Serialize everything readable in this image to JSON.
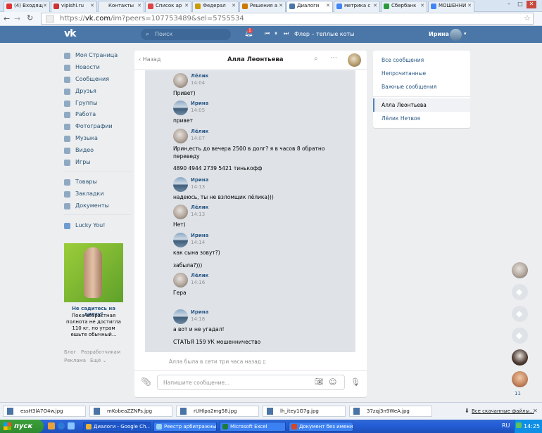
{
  "browser": {
    "tabs": [
      {
        "label": "(4) Входящ",
        "active": false
      },
      {
        "label": "vipishi.ru",
        "active": false
      },
      {
        "label": "Контакты",
        "active": false
      },
      {
        "label": "Список ар",
        "active": false
      },
      {
        "label": "Федерал",
        "active": false
      },
      {
        "label": "Решения а",
        "active": false
      },
      {
        "label": "Диалоги",
        "active": true
      },
      {
        "label": "метрика с",
        "active": false
      },
      {
        "label": "Сбербанк",
        "active": false
      },
      {
        "label": "МОШЕННИ",
        "active": false
      }
    ],
    "url_prefix": "https://",
    "url_host": "vk.com",
    "url_path": "/im?peers=107753489&sel=5755534"
  },
  "header": {
    "search_placeholder": "Поиск",
    "notification_count": "1",
    "now_playing": "Флер – теплые коты",
    "user_name": "Ирина"
  },
  "left_nav": {
    "items": [
      {
        "label": "Моя Страница",
        "icon": "home-icon"
      },
      {
        "label": "Новости",
        "icon": "news-icon"
      },
      {
        "label": "Сообщения",
        "icon": "messages-icon"
      },
      {
        "label": "Друзья",
        "icon": "friends-icon"
      },
      {
        "label": "Группы",
        "icon": "groups-icon"
      },
      {
        "label": "Работа",
        "icon": "work-icon"
      },
      {
        "label": "Фотографии",
        "icon": "photo-icon"
      },
      {
        "label": "Музыка",
        "icon": "music-icon"
      },
      {
        "label": "Видео",
        "icon": "video-icon"
      },
      {
        "label": "Игры",
        "icon": "games-icon"
      }
    ],
    "items2": [
      {
        "label": "Товары",
        "icon": "goods-icon"
      },
      {
        "label": "Закладки",
        "icon": "bookmarks-icon"
      },
      {
        "label": "Документы",
        "icon": "documents-icon"
      }
    ],
    "app": "Lucky You!",
    "ad_title": "Не садитесь на диету!",
    "ad_text": "Пока возрастная полнота не достигла 110 кг, по утрам ешьте обычный...",
    "footer": [
      "Блог",
      "Разработчикам",
      "Реклама",
      "Ещё"
    ]
  },
  "chat": {
    "back_label": "Назад",
    "title": "Алла Леонтьева",
    "messages": [
      {
        "author": "Лёлик",
        "time": "14:04",
        "lines": [
          "Привет)"
        ],
        "avatar": "lelik"
      },
      {
        "author": "Ирина",
        "time": "14:05",
        "lines": [
          "привет"
        ],
        "avatar": "irina"
      },
      {
        "author": "Лёлик",
        "time": "14:07",
        "lines": [
          "Ирин,есть до вечера 2500 в долг? я в часов 8 обратно",
          "переведу",
          "4890 4944 2739 5421 тинькофф"
        ],
        "avatar": "lelik"
      },
      {
        "author": "Ирина",
        "time": "14:13",
        "lines": [
          "надеюсь, ты не взломщик лёлика)))"
        ],
        "avatar": "irina"
      },
      {
        "author": "Лёлик",
        "time": "14:13",
        "lines": [
          "Нет)"
        ],
        "avatar": "lelik"
      },
      {
        "author": "Ирина",
        "time": "14:14",
        "lines": [
          "как сына зовут?)",
          "забыла?)))"
        ],
        "avatar": "irina"
      },
      {
        "author": "Лёлик",
        "time": "14:16",
        "lines": [
          "Гера"
        ],
        "avatar": "lelik"
      },
      {
        "author": "Ирина",
        "time": "14:18",
        "lines": [
          "а вот и не угадал!",
          "СТАТЬЯ 159 УК мошенничество"
        ],
        "avatar": "irina"
      }
    ],
    "last_seen": "Алла была в сети три часа назад",
    "input_placeholder": "Напишите сообщение..."
  },
  "right_panel": {
    "filters": [
      "Все сообщения",
      "Непрочитанные",
      "Важные сообщения"
    ],
    "dialogs": [
      "Алла Леонтьева",
      "Лёлик Нетвоя"
    ]
  },
  "floating_counter": "11",
  "downloads": {
    "files": [
      "essH3lA7O4w.jpg",
      "mKobeaZZNPs.jpg",
      "rUHlpa2mg58.jpg",
      "lh_itey1G7g.jpg",
      "37zqj3n9WeA.jpg"
    ],
    "all_label": "Все скачанные файлы..."
  },
  "taskbar": {
    "start_label": "пуск",
    "windows": [
      "Диалоги - Google Ch...",
      "Реестр арбитражны...",
      "Microsoft Excel",
      "Документ без имени..."
    ],
    "lang": "RU",
    "clock": "14:25"
  }
}
